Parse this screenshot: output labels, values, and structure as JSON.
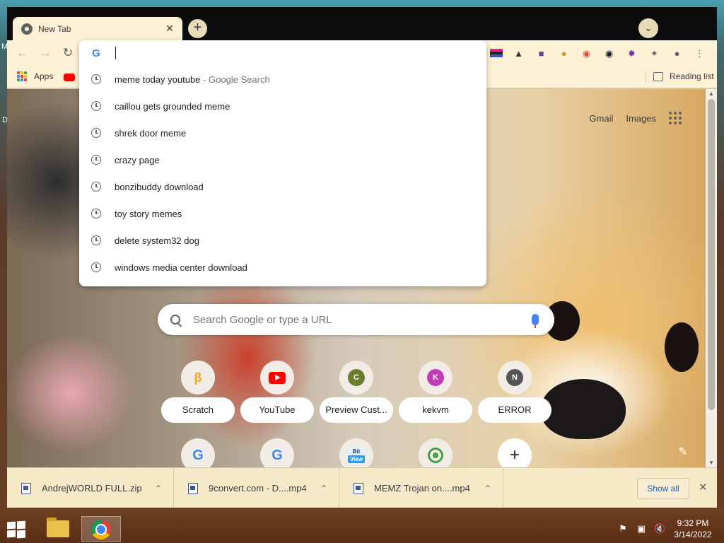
{
  "desktop": {
    "edge_letter_1": "M",
    "edge_letter_2": "D"
  },
  "tab": {
    "title": "New Tab",
    "close": "✕"
  },
  "tabstrip": {
    "new_tab": "+",
    "tab_search": "⌄"
  },
  "toolbar": {
    "back_icon": "arrow-left-icon",
    "forward_icon": "arrow-right-icon",
    "reload_icon": "reload-icon",
    "extensions": [
      "color-bars-extension-icon",
      "hat-icon",
      "space-invader-icon",
      "doge-icon",
      "color-wheel-icon",
      "globe-icon",
      "purple-gear-icon",
      "puzzle-icon",
      "profile-icon",
      "menu-dots-icon"
    ]
  },
  "bookmarks": {
    "apps_label": "Apps",
    "reading_list_label": "Reading list",
    "apps_colors": [
      "#ea4335",
      "#fbbc05",
      "#34a853",
      "#4285f4",
      "#ea4335",
      "#fbbc05",
      "#34a853",
      "#4285f4",
      "#ea4335"
    ]
  },
  "omnibox": {
    "value": "",
    "suggestions": [
      {
        "text": "meme today youtube",
        "suffix": " - Google Search"
      },
      {
        "text": "caillou gets grounded meme",
        "suffix": ""
      },
      {
        "text": "shrek door meme",
        "suffix": ""
      },
      {
        "text": "crazy page",
        "suffix": ""
      },
      {
        "text": "bonzibuddy download",
        "suffix": ""
      },
      {
        "text": "toy story memes",
        "suffix": ""
      },
      {
        "text": "delete system32 dog",
        "suffix": ""
      },
      {
        "text": "windows media center download",
        "suffix": ""
      }
    ]
  },
  "ntp": {
    "gmail": "Gmail",
    "images": "Images",
    "search_placeholder": "Search Google or type a URL",
    "shortcuts": [
      {
        "label": "Scratch",
        "icon": "scratch-icon"
      },
      {
        "label": "YouTube",
        "icon": "youtube-icon"
      },
      {
        "label": "Preview Cust...",
        "icon": "letter-c-icon",
        "letter": "C",
        "color": "#6b7d2b"
      },
      {
        "label": "kekvm",
        "icon": "letter-k-icon",
        "letter": "K",
        "color": "#c23bb7"
      },
      {
        "label": "ERROR",
        "icon": "letter-n-icon",
        "letter": "N",
        "color": "#555555"
      }
    ],
    "shortcuts_row2": [
      {
        "icon": "google-icon",
        "glyph": "G"
      },
      {
        "icon": "google-icon",
        "glyph": "G"
      },
      {
        "icon": "bitview-icon",
        "line1": "Bit",
        "line2": "View"
      },
      {
        "icon": "target-icon"
      },
      {
        "icon": "add-shortcut-icon",
        "glyph": "+"
      }
    ]
  },
  "downloads": {
    "items": [
      {
        "name": "AndrejWORLD FULL.zip"
      },
      {
        "name": "9convert.com - D....mp4"
      },
      {
        "name": "MEMZ Trojan on....mp4"
      }
    ],
    "show_all": "Show all",
    "close": "✕"
  },
  "taskbar": {
    "time": "9:32 PM",
    "date": "3/14/2022"
  }
}
